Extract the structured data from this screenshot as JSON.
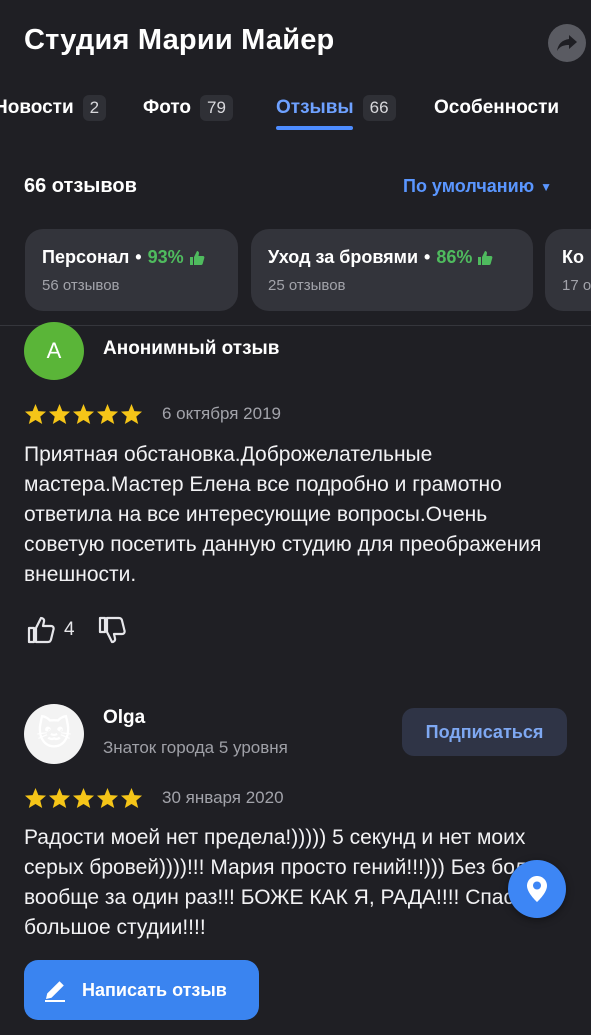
{
  "header": {
    "title": "Студия Марии Майер",
    "share_icon": "share-arrow-icon"
  },
  "tabs": [
    {
      "label": "Новости",
      "count": "2"
    },
    {
      "label": "Фото",
      "count": "79"
    },
    {
      "label": "Отзывы",
      "count": "66",
      "active": true
    },
    {
      "label": "Особенности"
    }
  ],
  "summary": {
    "count_label": "66 отзывов",
    "sort_label": "По умолчанию",
    "sort_icon": "triangle-down-icon"
  },
  "chips": [
    {
      "title": "Персонал",
      "sep": "•",
      "percent": "93%",
      "sub": "56 отзывов",
      "icon": "thumbs-up-icon"
    },
    {
      "title": "Уход за бровями",
      "sep": "•",
      "percent": "86%",
      "sub": "25 отзывов",
      "icon": "thumbs-up-icon"
    },
    {
      "title": "Ко",
      "sub": "17 о"
    }
  ],
  "reviews": [
    {
      "avatar_letter": "A",
      "author": "Анонимный отзыв",
      "rating": 5,
      "date": "6 октября 2019",
      "text": "Приятная обстановка.Доброжелательные мастера.Мастер Елена все подробно и грамотно ответила на все интересующие вопросы.Очень советую посетить данную студию для преображения внешности.",
      "likes": "4"
    },
    {
      "avatar_icon": "cat-face-icon",
      "author": "Olga",
      "subtitle": "Знаток города 5 уровня",
      "subscribe_label": "Подписаться",
      "rating": 5,
      "date": "30 января 2020",
      "text": "Радости моей нет предела!))))) 5 секунд и нет моих серых бровей))))!!! Мария просто гений!!!))) Без боли вообще за один раз!!! БОЖЕ КАК Я, РАДА!!!! Спасибо большое студии!!!!"
    }
  ],
  "actions": {
    "write_review": "Написать отзыв",
    "write_icon": "pencil-icon",
    "fab_icon": "map-pin-icon"
  },
  "colors": {
    "background": "#1f1f24",
    "accent": "#4d8cff",
    "positive": "#4fbb5e",
    "star": "#f5c518",
    "avatar_green": "#5ab538"
  }
}
